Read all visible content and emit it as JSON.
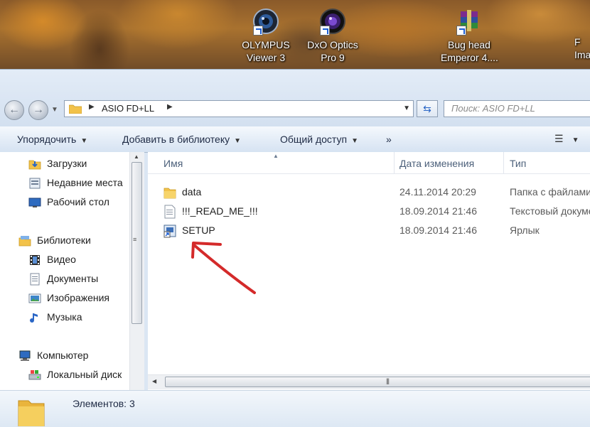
{
  "desktop": {
    "icons": [
      {
        "name": "olympus",
        "line1": "OLYMPUS",
        "line2": "Viewer 3"
      },
      {
        "name": "dxo",
        "line1": "DxO Optics",
        "line2": "Pro 9"
      },
      {
        "name": "winrar",
        "line1": "Bug head",
        "line2": "Emperor 4...."
      },
      {
        "name": "partial",
        "line1": "F",
        "line2": "Ima"
      }
    ]
  },
  "window": {
    "address": {
      "path": "ASIO FD+LL"
    },
    "search": {
      "placeholder": "Поиск: ASIO FD+LL"
    },
    "toolbar": {
      "organize": "Упорядочить",
      "add_to_library": "Добавить в библиотеку",
      "share": "Общий доступ",
      "more": "»"
    },
    "nav": {
      "favorites": [
        {
          "label": "Загрузки",
          "icon": "downloads-folder-icon"
        },
        {
          "label": "Недавние места",
          "icon": "recent-places-icon"
        },
        {
          "label": "Рабочий стол",
          "icon": "desktop-icon"
        }
      ],
      "libraries": {
        "label": "Библиотеки",
        "icon": "libraries-icon"
      },
      "library_items": [
        {
          "label": "Видео",
          "icon": "video-icon"
        },
        {
          "label": "Документы",
          "icon": "documents-icon"
        },
        {
          "label": "Изображения",
          "icon": "pictures-icon"
        },
        {
          "label": "Музыка",
          "icon": "music-icon"
        }
      ],
      "computer": {
        "label": "Компьютер",
        "icon": "computer-icon"
      },
      "computer_items": [
        {
          "label": "Локальный диск",
          "icon": "local-disk-icon"
        }
      ]
    },
    "columns": {
      "name": "Имя",
      "date": "Дата изменения",
      "type": "Тип"
    },
    "files": [
      {
        "name": "data",
        "date": "24.11.2014 20:29",
        "type": "Папка с файлами",
        "icon": "folder-icon"
      },
      {
        "name": "!!!_READ_ME_!!!",
        "date": "18.09.2014 21:46",
        "type": "Текстовый документ",
        "icon": "text-file-icon"
      },
      {
        "name": "SETUP",
        "date": "18.09.2014 21:46",
        "type": "Ярлык",
        "icon": "shortcut-icon"
      }
    ],
    "status": {
      "count": "Элементов: 3"
    }
  },
  "colors": {
    "annotation_arrow": "#d42a2a",
    "folder": "#f2c24a",
    "accent": "#2a66c6"
  }
}
